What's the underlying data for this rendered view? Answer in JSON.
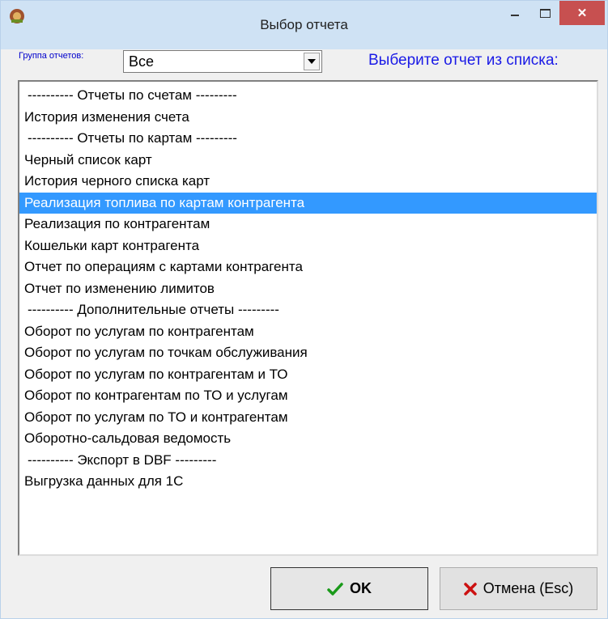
{
  "window": {
    "title": "Выбор отчета"
  },
  "filter": {
    "group_label": "Группа отчетов:",
    "group_value": "Все",
    "hint": "Выберите отчет из списка:"
  },
  "reports": [
    {
      "label": "---------- Отчеты по счетам ---------",
      "kind": "separator"
    },
    {
      "label": "История изменения счета",
      "kind": "item"
    },
    {
      "label": "---------- Отчеты по картам ---------",
      "kind": "separator"
    },
    {
      "label": "Черный список карт",
      "kind": "item"
    },
    {
      "label": "История черного списка карт",
      "kind": "item"
    },
    {
      "label": "Реализация топлива по картам контрагента",
      "kind": "item",
      "selected": true
    },
    {
      "label": "Реализация по контрагентам",
      "kind": "item"
    },
    {
      "label": "Кошельки карт контрагента",
      "kind": "item"
    },
    {
      "label": "Отчет по операциям с картами контрагента",
      "kind": "item"
    },
    {
      "label": "Отчет по изменению лимитов",
      "kind": "item"
    },
    {
      "label": "---------- Дополнительные отчеты ---------",
      "kind": "separator"
    },
    {
      "label": "Оборот по услугам по контрагентам",
      "kind": "item"
    },
    {
      "label": "Оборот по услугам по точкам обслуживания",
      "kind": "item"
    },
    {
      "label": "Оборот по услугам по контрагентам и ТО",
      "kind": "item"
    },
    {
      "label": "Оборот по контрагентам по ТО и услугам",
      "kind": "item"
    },
    {
      "label": "Оборот по услугам по ТО и контрагентам",
      "kind": "item"
    },
    {
      "label": "Оборотно-сальдовая ведомость",
      "kind": "item"
    },
    {
      "label": "---------- Экспорт в DBF ---------",
      "kind": "separator"
    },
    {
      "label": "Выгрузка данных для 1С",
      "kind": "item"
    }
  ],
  "buttons": {
    "ok": "OK",
    "cancel": "Отмена (Esc)"
  },
  "icons": {
    "ok": "checkmark-icon",
    "cancel": "cross-icon",
    "app": "app-icon"
  },
  "colors": {
    "selection": "#3399ff",
    "close_button": "#c75050",
    "hint_text": "#1a1ae6",
    "ok_icon": "#1a9a1a",
    "cancel_icon": "#cc1111"
  }
}
